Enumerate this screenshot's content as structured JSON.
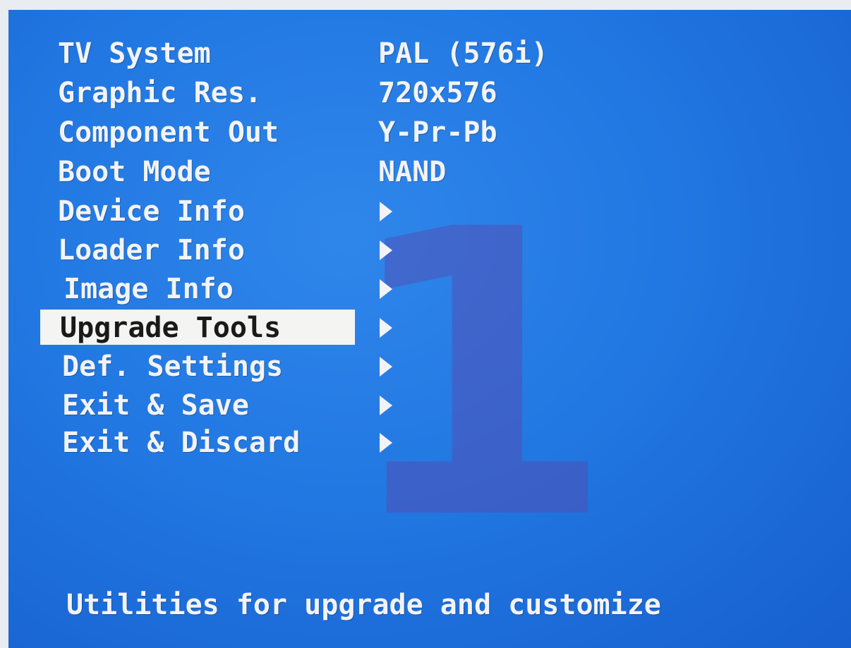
{
  "menu": {
    "items": [
      {
        "label": "TV System",
        "value": "PAL (576i)"
      },
      {
        "label": "Graphic Res.",
        "value": "720x576"
      },
      {
        "label": "Component Out",
        "value": "Y-Pr-Pb"
      },
      {
        "label": "Boot Mode",
        "value": "NAND"
      },
      {
        "label": "Device Info",
        "submenu": true
      },
      {
        "label": "Loader Info",
        "submenu": true
      },
      {
        "label": "Image Info",
        "submenu": true
      },
      {
        "label": "Upgrade Tools",
        "submenu": true,
        "selected": true
      },
      {
        "label": "Def. Settings",
        "submenu": true
      },
      {
        "label": "Exit & Save",
        "submenu": true
      },
      {
        "label": "Exit & Discard",
        "submenu": true
      }
    ]
  },
  "watermark": {
    "text": "1"
  },
  "status": {
    "text": "Utilities for upgrade and customize"
  },
  "colors": {
    "background": "#2278e2",
    "text": "#f2f3f7",
    "highlight": "#f4f4f2",
    "highlight_text": "#1a1a1a",
    "watermark": "#5a46aa"
  }
}
